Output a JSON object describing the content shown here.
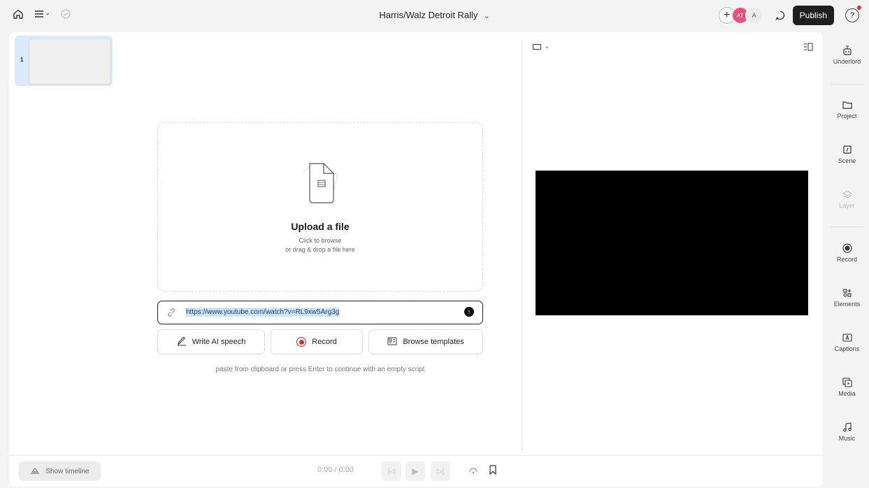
{
  "topbar": {
    "title": "Harris/Walz Detroit Rally",
    "title_chevron": "⌄",
    "avatars": [
      {
        "initials": "AT"
      },
      {
        "initials": "A"
      }
    ],
    "publish_label": "Publish",
    "help_label": "?"
  },
  "scenes": [
    {
      "number": "1"
    }
  ],
  "upload": {
    "title": "Upload a file",
    "subtitle_line1": "Click to browse",
    "subtitle_line2": "or drag & drop a file here"
  },
  "url_input": {
    "value": "https://www.youtube.com/watch?v=RL9xw5Arg3g"
  },
  "actions": [
    {
      "label": "Write AI speech",
      "icon": "pen-icon"
    },
    {
      "label": "Record",
      "icon": "record-icon"
    },
    {
      "label": "Browse templates",
      "icon": "template-icon"
    }
  ],
  "hint": "paste from clipboard or press Enter to continue with an empty script",
  "player": {
    "show_timeline_label": "Show timeline",
    "time": "0:00 / 0:00",
    "canvas_color": "#000000"
  },
  "rightnav": [
    {
      "label": "Underlord",
      "icon": "robot-icon",
      "disabled": false
    },
    {
      "label": "Project",
      "icon": "folder-icon",
      "disabled": false
    },
    {
      "label": "Scene",
      "icon": "scene-icon",
      "disabled": false
    },
    {
      "label": "Layer",
      "icon": "layers-icon",
      "disabled": true
    },
    {
      "label": "Record",
      "icon": "record-icon",
      "disabled": false
    },
    {
      "label": "Elements",
      "icon": "elements-icon",
      "disabled": false
    },
    {
      "label": "Captions",
      "icon": "captions-icon",
      "disabled": false
    },
    {
      "label": "Media",
      "icon": "media-icon",
      "disabled": false
    },
    {
      "label": "Music",
      "icon": "music-icon",
      "disabled": false
    }
  ],
  "colors": {
    "accent_record": "#d42a2a",
    "publish_bg": "#1f1f1f",
    "selection": "#dbeafb"
  }
}
